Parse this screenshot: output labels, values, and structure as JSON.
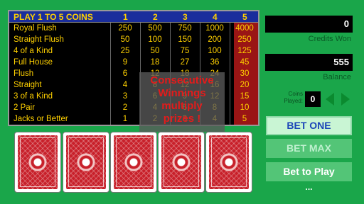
{
  "paytable": {
    "title": "PLAY 1 TO 5 COINS",
    "coin_columns": [
      "1",
      "2",
      "3",
      "4",
      "5"
    ],
    "highlight_color": "#9a1515",
    "header_color": "#1a2d9c",
    "text_color": "#ffd100",
    "rows": [
      {
        "hand": "Royal Flush",
        "values": [
          "250",
          "500",
          "750",
          "1000",
          "4000"
        ]
      },
      {
        "hand": "Straight Flush",
        "values": [
          "50",
          "100",
          "150",
          "200",
          "250"
        ]
      },
      {
        "hand": "4 of a Kind",
        "values": [
          "25",
          "50",
          "75",
          "100",
          "125"
        ]
      },
      {
        "hand": "Full House",
        "values": [
          "9",
          "18",
          "27",
          "36",
          "45"
        ]
      },
      {
        "hand": "Flush",
        "values": [
          "6",
          "12",
          "18",
          "24",
          "30"
        ]
      },
      {
        "hand": "Straight",
        "values": [
          "4",
          "8",
          "12",
          "16",
          "20"
        ]
      },
      {
        "hand": "3 of a Kind",
        "values": [
          "3",
          "6",
          "9",
          "12",
          "15"
        ]
      },
      {
        "hand": "2 Pair",
        "values": [
          "2",
          "4",
          "6",
          "8",
          "10"
        ]
      },
      {
        "hand": "Jacks or Better",
        "values": [
          "1",
          "2",
          "3",
          "4",
          "5"
        ]
      }
    ]
  },
  "overlay": {
    "lines": [
      "Consecutive",
      "Winnings",
      "multiply",
      "prizes !"
    ]
  },
  "cards": [
    {
      "face": "back"
    },
    {
      "face": "back"
    },
    {
      "face": "back"
    },
    {
      "face": "back"
    },
    {
      "face": "back"
    }
  ],
  "credits_won": {
    "value": "0",
    "label": "Credits Won"
  },
  "balance": {
    "value": "555",
    "label": "Balance"
  },
  "coins_played": {
    "label_line1": "Coins",
    "label_line2": "Played:",
    "value": "0"
  },
  "arrows": {
    "left_icon": "triangle-left-icon",
    "right_icon": "triangle-right-icon",
    "color": "#0b8a2f"
  },
  "buttons": {
    "bet_one": "BET ONE",
    "bet_max": "BET MAX",
    "bet_to_play": "Bet to Play"
  },
  "more_indicator": "..."
}
